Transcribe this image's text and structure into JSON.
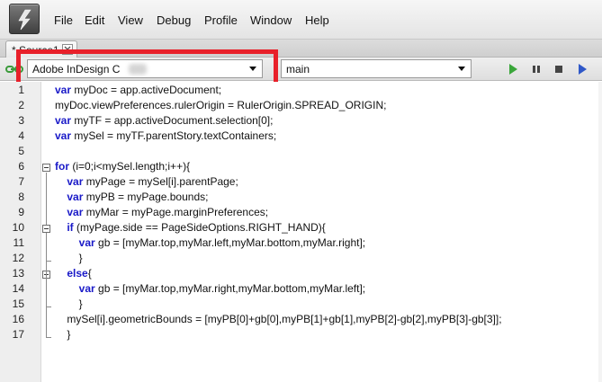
{
  "menubar": {
    "logo_icon": "extendscript-logo-icon",
    "items": [
      "File",
      "Edit",
      "View",
      "Debug",
      "Profile",
      "Window",
      "Help"
    ]
  },
  "tabs": [
    {
      "label": "* Source1",
      "close_icon": "close-icon"
    }
  ],
  "toolbar": {
    "link_icon": "link-status-icon",
    "target_app": "Adobe InDesign C",
    "target_function": "main",
    "buttons": [
      "run-icon",
      "pause-icon",
      "stop-icon",
      "step-icon"
    ],
    "colors": {
      "run": "#3aa63a",
      "pause": "#444444",
      "stop": "#444444",
      "step": "#2f58c8",
      "highlight": "#e8202a"
    }
  },
  "editor": {
    "lines": [
      {
        "n": "1",
        "text": "var myDoc = app.activeDocument;"
      },
      {
        "n": "2",
        "text": "myDoc.viewPreferences.rulerOrigin = RulerOrigin.SPREAD_ORIGIN;"
      },
      {
        "n": "3",
        "text": "var myTF = app.activeDocument.selection[0];"
      },
      {
        "n": "4",
        "text": "var mySel = myTF.parentStory.textContainers;"
      },
      {
        "n": "5",
        "text": ""
      },
      {
        "n": "6",
        "text": "for (i=0;i<mySel.length;i++){"
      },
      {
        "n": "7",
        "text": "    var myPage = mySel[i].parentPage;"
      },
      {
        "n": "8",
        "text": "    var myPB = myPage.bounds;"
      },
      {
        "n": "9",
        "text": "    var myMar = myPage.marginPreferences;"
      },
      {
        "n": "10",
        "text": "    if (myPage.side == PageSideOptions.RIGHT_HAND){"
      },
      {
        "n": "11",
        "text": "        var gb = [myMar.top,myMar.left,myMar.bottom,myMar.right];"
      },
      {
        "n": "12",
        "text": "        }"
      },
      {
        "n": "13",
        "text": "    else{"
      },
      {
        "n": "14",
        "text": "        var gb = [myMar.top,myMar.right,myMar.bottom,myMar.left];"
      },
      {
        "n": "15",
        "text": "        }"
      },
      {
        "n": "16",
        "text": "    mySel[i].geometricBounds = [myPB[0]+gb[0],myPB[1]+gb[1],myPB[2]-gb[2],myPB[3]-gb[3]];"
      },
      {
        "n": "17",
        "text": "    }"
      }
    ]
  }
}
